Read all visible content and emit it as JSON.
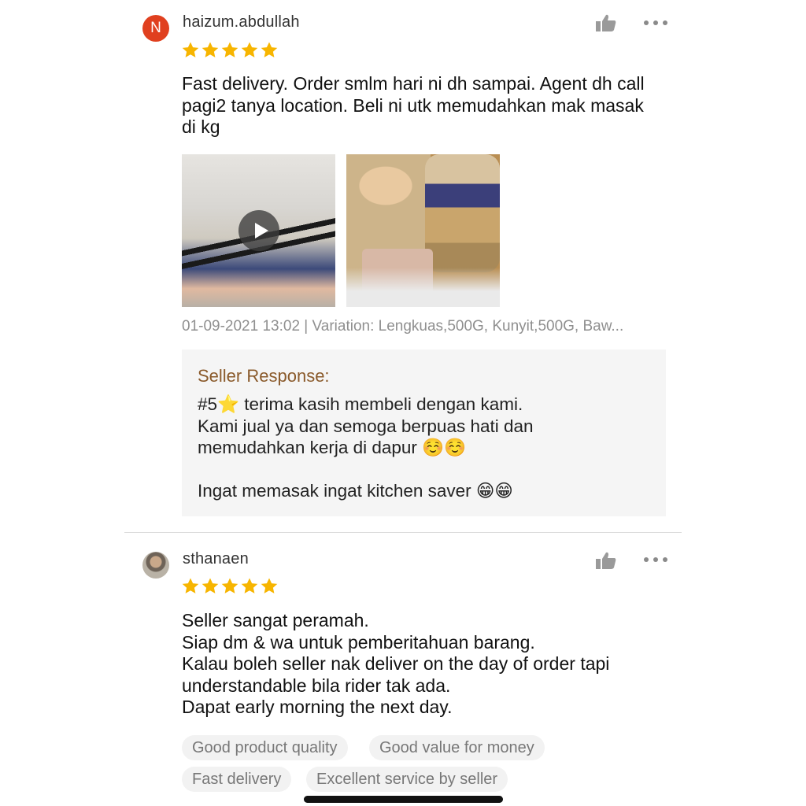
{
  "colors": {
    "star": "#f7b500",
    "avatar_bg": "#e0401f",
    "seller_title": "#8a5a2b",
    "tag_bg": "#f2f2f2"
  },
  "reviews": [
    {
      "avatar_letter": "N",
      "username": "haizum.abdullah",
      "rating": 5,
      "text": "Fast delivery. Order smlm hari ni dh sampai. Agent dh call\npagi2 tanya location. Beli ni utk memudahkan mak masak\ndi kg",
      "media": [
        {
          "type": "video",
          "icon": "play-icon"
        },
        {
          "type": "image"
        }
      ],
      "meta": "01-09-2021 13:02 | Variation: Lengkuas,500G, Kunyit,500G, Baw...",
      "seller_response": {
        "title": "Seller Response:",
        "text": "#5⭐ terima kasih membeli dengan kami.\nKami jual ya dan semoga berpuas hati dan\nmemudahkan kerja di dapur ☺️☺️\n\nIngat memasak ingat kitchen saver 😁😁"
      }
    },
    {
      "username": "sthanaen",
      "rating": 5,
      "text": "Seller sangat peramah.\nSiap dm & wa untuk pemberitahuan barang.\nKalau boleh seller nak deliver on the day of order tapi\nunderstandable bila rider tak ada.\nDapat early morning the next day.",
      "tags": [
        "Good product quality",
        "Good value for money",
        "Fast delivery",
        "Excellent service by seller"
      ]
    }
  ]
}
